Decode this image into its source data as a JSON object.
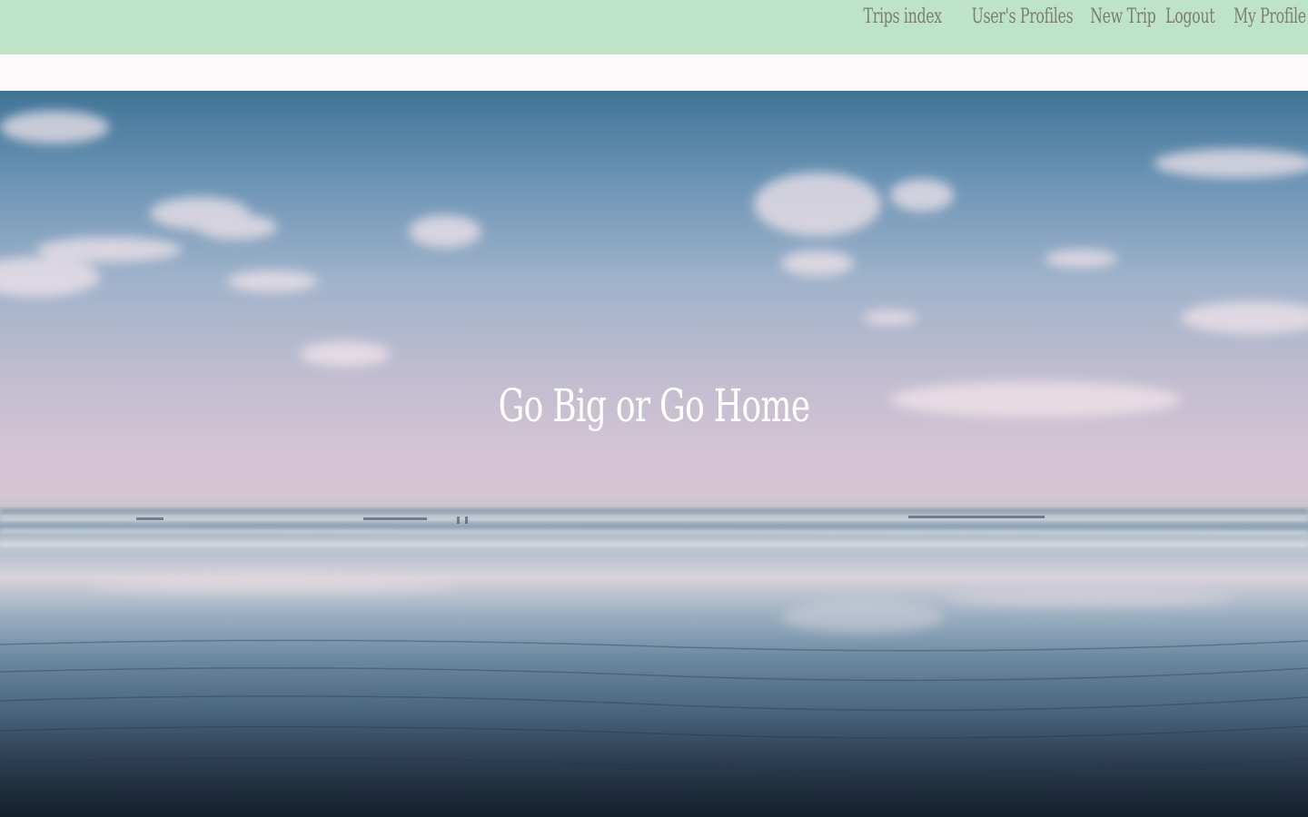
{
  "nav": {
    "items": [
      {
        "label": "Trips index"
      },
      {
        "label": "User's Profiles"
      },
      {
        "label": "New Trip"
      },
      {
        "label": "Logout"
      },
      {
        "label": "My Profile"
      }
    ]
  },
  "hero": {
    "title": "Go Big or Go Home",
    "image": "beach-sunset-photo"
  },
  "colors": {
    "topbar": "#bee3c6",
    "nav_text": "#7a7f74",
    "page_bg": "#fbf9fa",
    "hero_title": "#ffffff"
  }
}
